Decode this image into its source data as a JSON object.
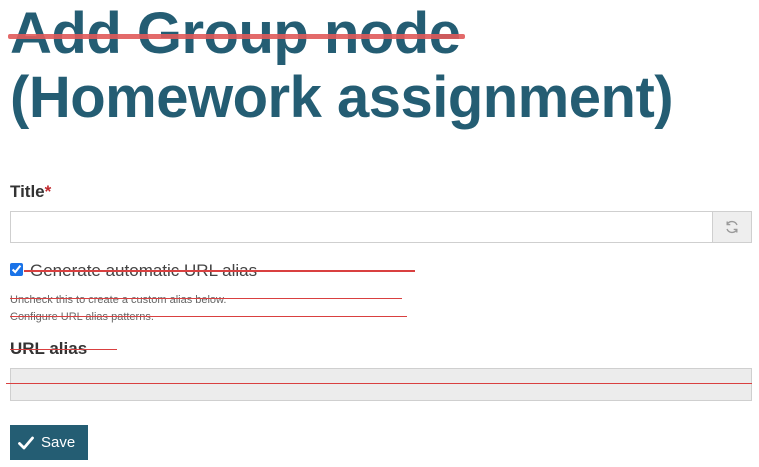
{
  "page": {
    "title_struck": "Add Group node",
    "title_rest": " (Homework assignment)"
  },
  "form": {
    "title_label": "Title",
    "required_mark": "*",
    "title_value": "",
    "auto_alias_label": "Generate automatic URL alias",
    "auto_alias_checked": true,
    "description_1": "Uncheck this to create a custom alias below.",
    "description_2": "Configure URL alias patterns.",
    "url_alias_label": "URL alias",
    "url_alias_value": "",
    "save_label": "Save"
  },
  "icons": {
    "refresh": "refresh-icon",
    "save": "checkmark-icon"
  },
  "colors": {
    "title": "#245d73",
    "button": "#245d73",
    "strike": "#e05a5a",
    "required": "#c0262b"
  }
}
